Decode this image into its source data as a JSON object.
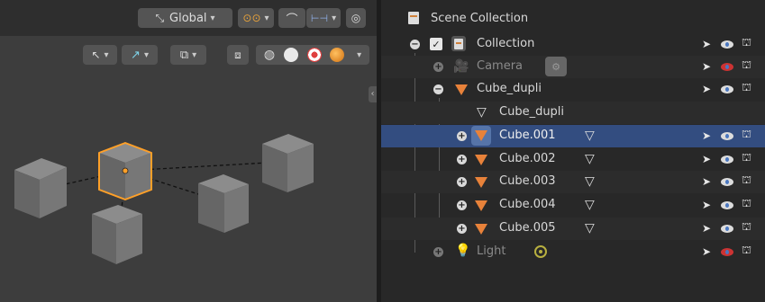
{
  "viewport_header": {
    "orientation_label": "Global",
    "icons": [
      "transform-orientation-icon",
      "snap-icon",
      "proportional-edit-icon",
      "mirror-icon",
      "overlay-icon"
    ]
  },
  "viewport_subheader": {
    "icons": [
      "gizmo-icon",
      "object-types-icon",
      "overlay-icon",
      "xray-icon",
      "shading-wire-icon",
      "shading-solid-icon",
      "shading-material-icon",
      "shading-rendered-icon"
    ]
  },
  "colors": {
    "accent": "#334d80",
    "selection_orange": "#ffa028",
    "mesh_icon": "#e8823a"
  },
  "outliner": {
    "scene_collection": "Scene Collection",
    "rows": [
      {
        "label": "Collection",
        "type": "collection",
        "checked": true
      },
      {
        "label": "Camera",
        "type": "camera",
        "dim": true,
        "hidden_viewport": true
      },
      {
        "label": "Cube_dupli",
        "type": "mesh-object"
      },
      {
        "label": "Cube_dupli",
        "type": "mesh-data"
      },
      {
        "label": "Cube.001",
        "type": "mesh-object",
        "selected": true
      },
      {
        "label": "Cube.002",
        "type": "mesh-object"
      },
      {
        "label": "Cube.003",
        "type": "mesh-object"
      },
      {
        "label": "Cube.004",
        "type": "mesh-object"
      },
      {
        "label": "Cube.005",
        "type": "mesh-object"
      },
      {
        "label": "Light",
        "type": "light",
        "dim": true,
        "hidden_viewport": true
      }
    ]
  }
}
